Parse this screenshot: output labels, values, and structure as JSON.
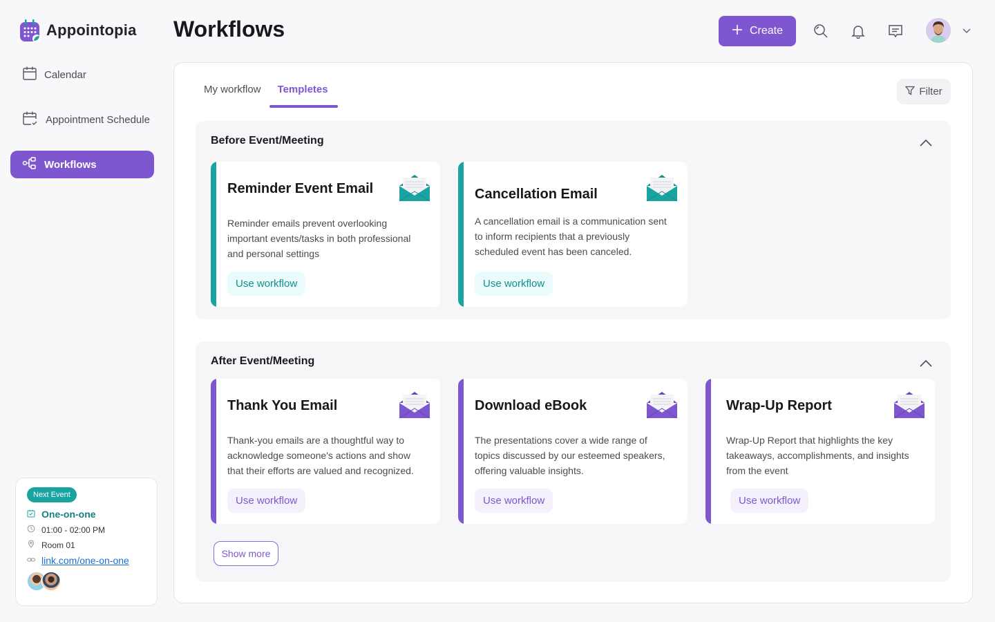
{
  "app": {
    "name": "Appointopia"
  },
  "sidebar": {
    "items": [
      {
        "label": "Calendar",
        "icon": "calendar-icon",
        "active": false
      },
      {
        "label": "Appointment Schedule",
        "icon": "calendar-check-icon",
        "active": false
      },
      {
        "label": "Workflows",
        "icon": "workflow-icon",
        "active": true
      }
    ],
    "next_event": {
      "badge": "Next Event",
      "title": "One-on-one",
      "time": "01:00 - 02:00 PM",
      "location": "Room 01",
      "link": "link.com/one-on-one",
      "attendees_count": 2
    }
  },
  "header": {
    "title": "Workflows",
    "create_label": "Create",
    "icons": [
      "search-icon",
      "bell-icon",
      "message-icon"
    ]
  },
  "main": {
    "tabs": [
      {
        "label": "My workflow",
        "active": false
      },
      {
        "label": "Templetes",
        "active": true
      }
    ],
    "filter_label": "Filter",
    "sections": [
      {
        "title": "Before Event/Meeting",
        "accent": "#19a3a1",
        "cards": [
          {
            "title": "Reminder Event Email",
            "description": "Reminder emails prevent overlooking important events/tasks in both professional and personal settings",
            "button": "Use workflow"
          },
          {
            "title": "Cancellation Email",
            "description": "A cancellation email is a communication sent to inform recipients that a previously scheduled event has been canceled.",
            "button": "Use workflow"
          }
        ]
      },
      {
        "title": "After Event/Meeting",
        "accent": "#7e57d0",
        "cards": [
          {
            "title": "Thank You Email",
            "description": "Thank-you emails are a thoughtful way to acknowledge someone's actions and show that their efforts are valued and recognized.",
            "button": "Use workflow"
          },
          {
            "title": "Download eBook",
            "description": "The presentations cover a wide range of topics discussed by our esteemed speakers, offering valuable insights.",
            "button": "Use workflow"
          },
          {
            "title": "Wrap-Up Report",
            "description": "Wrap-Up Report that highlights the key takeaways, accomplishments, and insights from the event",
            "button": "Use workflow"
          }
        ],
        "show_more_label": "Show more"
      }
    ]
  },
  "colors": {
    "brand": "#7e57d0",
    "teal": "#19a3a1"
  }
}
